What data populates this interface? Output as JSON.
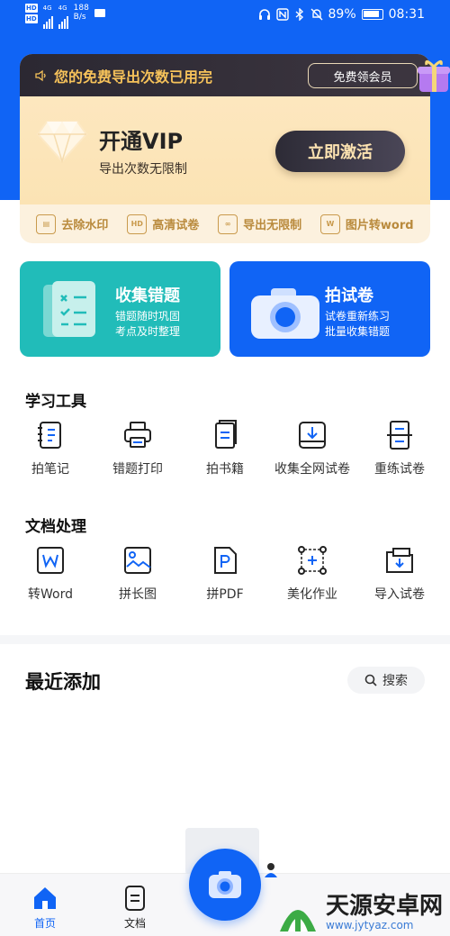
{
  "status_bar": {
    "hd1": "HD",
    "hd2": "HD",
    "net1": "4G",
    "net2": "4G",
    "speed_value": "188",
    "speed_unit": "B/s",
    "battery": "89%",
    "time": "08:31"
  },
  "vip": {
    "notice": "您的免费导出次数已用完",
    "free_button": "免费领会员",
    "title": "开通VIP",
    "subtitle": "导出次数无限制",
    "activate_button": "立即激活",
    "perks": [
      {
        "icon": "stamp-icon",
        "label": "去除水印"
      },
      {
        "icon": "hd-icon",
        "label": "高清试卷"
      },
      {
        "icon": "infinity-export-icon",
        "label": "导出无限制"
      },
      {
        "icon": "word-icon",
        "label": "图片转word"
      }
    ]
  },
  "features": [
    {
      "title": "收集错题",
      "desc1": "错题随时巩固",
      "desc2": "考点及时整理",
      "color": "#21bcb9"
    },
    {
      "title": "拍试卷",
      "desc1": "试卷重新练习",
      "desc2": "批量收集错题",
      "color": "#1064f5"
    }
  ],
  "study_tools": {
    "title": "学习工具",
    "items": [
      "拍笔记",
      "错题打印",
      "拍书籍",
      "收集全网试卷",
      "重练试卷"
    ]
  },
  "doc_tools": {
    "title": "文档处理",
    "items": [
      "转Word",
      "拼长图",
      "拼PDF",
      "美化作业",
      "导入试卷"
    ]
  },
  "recent": {
    "title": "最近添加",
    "search_label": "搜索"
  },
  "nav": {
    "home": "首页",
    "docs": "文档"
  },
  "watermark": {
    "name": "天源安卓网",
    "url": "www.jytyaz.com"
  },
  "colors": {
    "primary": "#1064f5",
    "teal": "#21bcb9",
    "gold": "#f6c25a"
  }
}
